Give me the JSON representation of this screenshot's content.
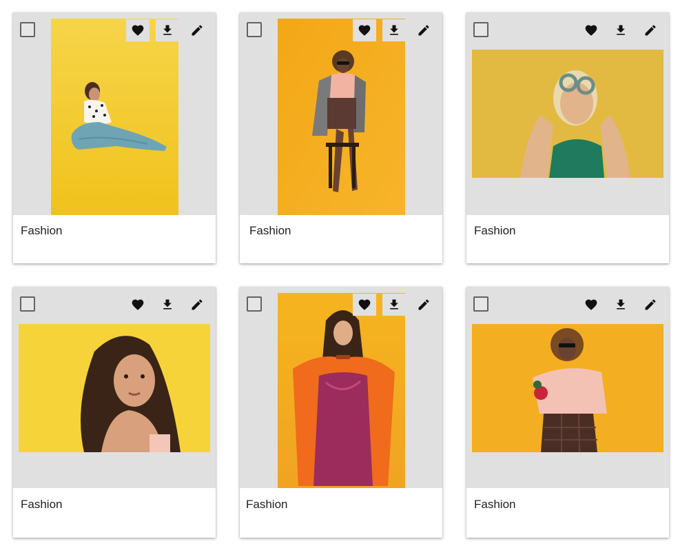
{
  "page": {
    "background": "#ffffff",
    "card_background": "#ffffff",
    "media_background": "#e0e0e0"
  },
  "actions": {
    "favorite_icon": "heart-icon",
    "download_icon": "download-icon",
    "edit_icon": "pencil-icon"
  },
  "cards": [
    {
      "title": "Fashion",
      "image": "Woman in polka-dot blouse and blue skirt sitting on yellow backdrop",
      "orientation": "portrait",
      "selected": false
    },
    {
      "title": "Fashion",
      "image": "Woman in plaid coat and skirt sitting on stool, orange backdrop",
      "orientation": "portrait",
      "selected": false
    },
    {
      "title": "Fashion",
      "image": "Blonde woman holding round sunglasses, yellow wall",
      "orientation": "landscape",
      "selected": false
    },
    {
      "title": "Fashion",
      "image": "Woman with long curly hair, yellow background",
      "orientation": "landscape",
      "selected": false
    },
    {
      "title": "Fashion",
      "image": "Woman in orange coat and purple dress, yellow background",
      "orientation": "portrait",
      "selected": false
    },
    {
      "title": "Fashion",
      "image": "Woman with curly hair in pink sweater and sunglasses, orange background",
      "orientation": "landscape",
      "selected": false
    }
  ]
}
